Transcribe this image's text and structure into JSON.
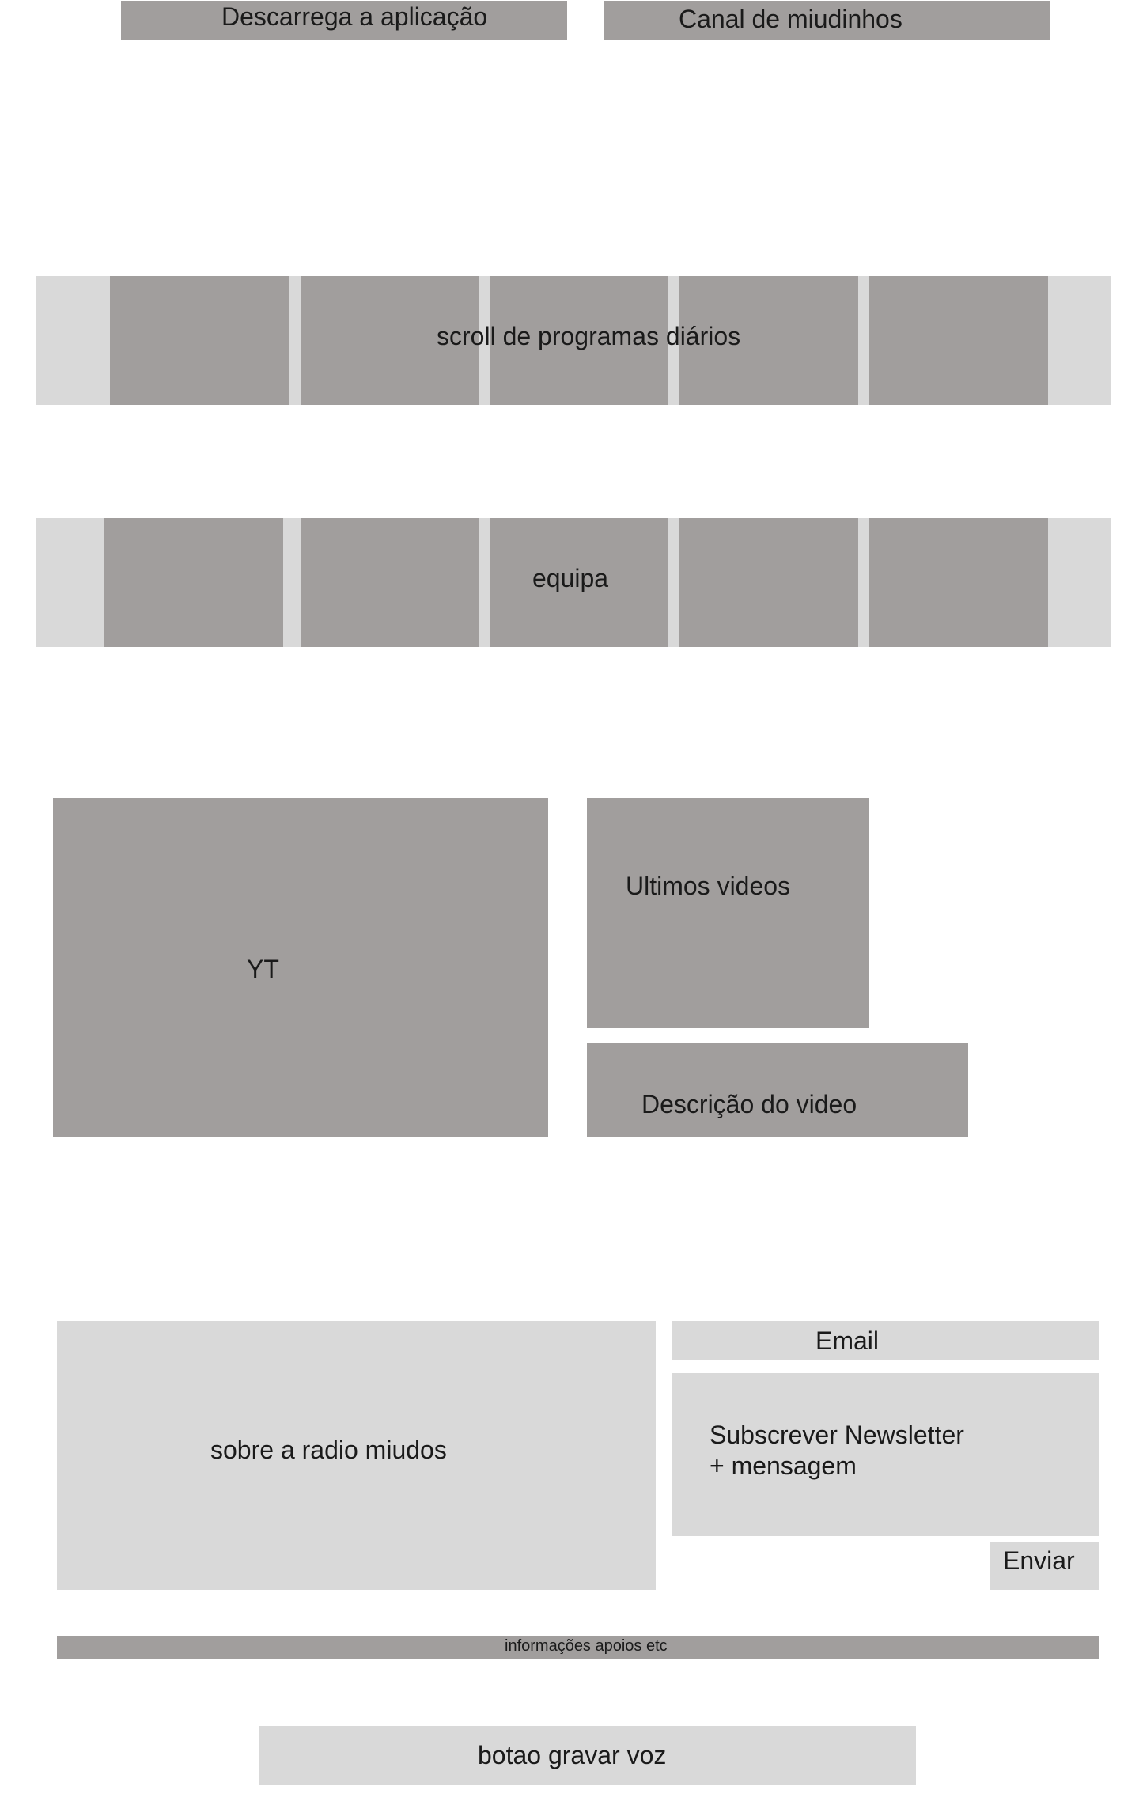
{
  "top_buttons": {
    "download_app": "Descarrega a aplicação",
    "kids_channel": "Canal de miudinhos"
  },
  "programs_strip": {
    "label": "scroll de programas diários",
    "cards": [
      "",
      "",
      "",
      "",
      ""
    ]
  },
  "team_strip": {
    "label": "equipa",
    "cards": [
      "",
      "",
      "",
      "",
      ""
    ]
  },
  "video_section": {
    "player_label": "YT",
    "latest_videos_label": "Ultimos videos",
    "description_label": "Descrição do video"
  },
  "about": {
    "label": "sobre a radio miudos"
  },
  "newsletter": {
    "email_label": "Email",
    "message_line1": "Subscrever Newsletter",
    "message_line2": "+ mensagem",
    "send_label": "Enviar"
  },
  "info_bar": {
    "label": "informações apoios etc"
  },
  "record_voice": {
    "label": "botao gravar voz"
  },
  "colors": {
    "dark_block": "#a19e9d",
    "light_block": "#d9d9d9",
    "background": "#ffffff",
    "text": "#1a1a1a"
  }
}
